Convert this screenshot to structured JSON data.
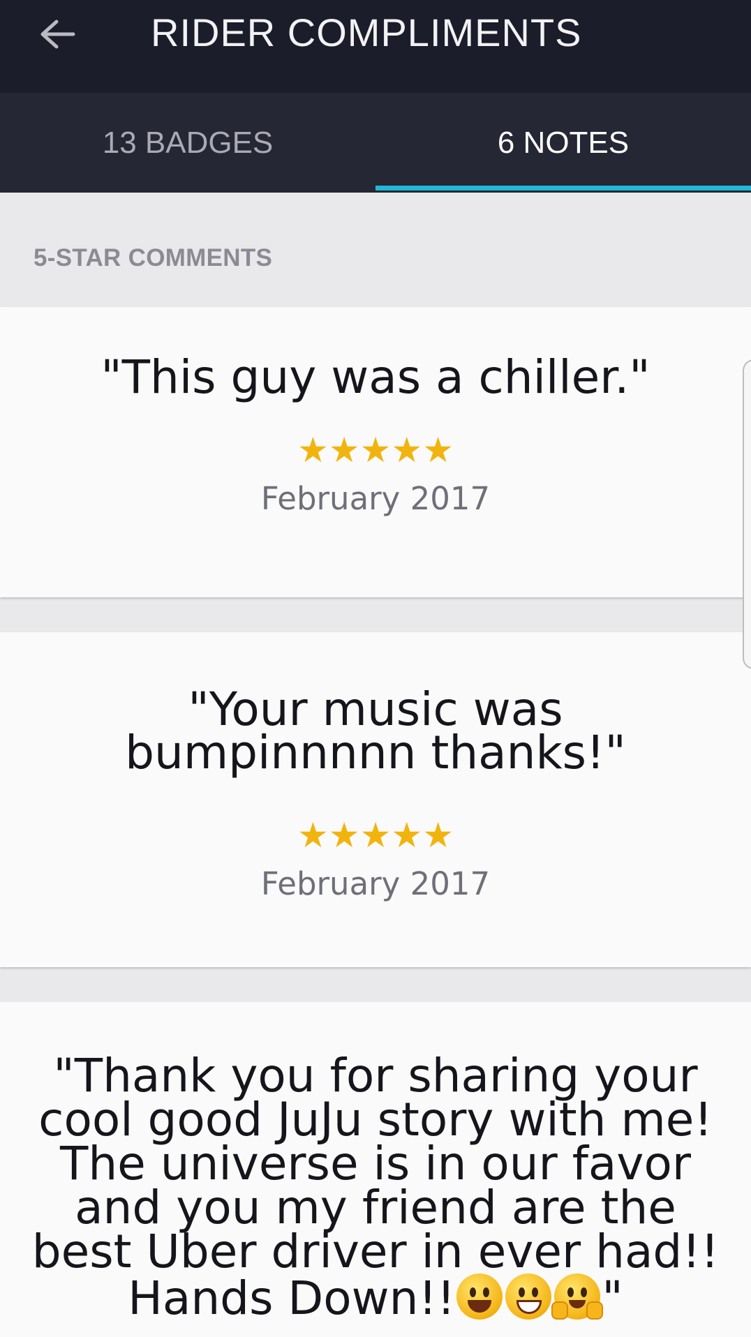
{
  "header": {
    "title": "RIDER COMPLIMENTS",
    "back_icon": "arrow-left-icon"
  },
  "tabs": [
    {
      "label": "13 BADGES",
      "active": false
    },
    {
      "label": "6 NOTES",
      "active": true
    }
  ],
  "colors": {
    "header_bg": "#1c1d2b",
    "tabs_bg": "#262735",
    "tab_indicator": "#1fb8d6",
    "star": "#f1b40f",
    "page_bg": "#e9e9eb"
  },
  "section": {
    "heading": "5-STAR COMMENTS"
  },
  "comments": [
    {
      "quote": "\"This guy was a chiller.\"",
      "stars": "★★★★★",
      "rating": 5,
      "date": "February 2017"
    },
    {
      "quote": "\"Your music was bumpinnnnn thanks!\"",
      "stars": "★★★★★",
      "rating": 5,
      "date": "February 2017"
    },
    {
      "quote_main": "\"Thank you for sharing your cool good JuJu story with me! The universe is in our favor and you my friend are the best Uber driver in ever had!! Hands Down!!",
      "quote_end": "\"",
      "emojis": [
        "grinning-face-icon",
        "grinning-face-smiling-eyes-icon",
        "hugging-face-icon"
      ]
    }
  ]
}
